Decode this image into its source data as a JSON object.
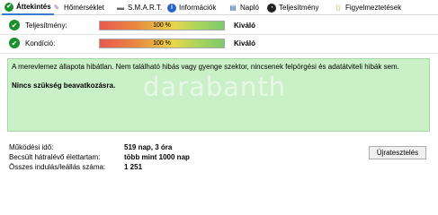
{
  "tabs": [
    {
      "label": "Áttekintés",
      "icon": "green-check-icon",
      "active": true
    },
    {
      "label": "Hőmérséklet",
      "icon": "thermometer-pencil-icon",
      "active": false
    },
    {
      "label": "S.M.A.R.T.",
      "icon": "disk-icon",
      "active": false
    },
    {
      "label": "Információk",
      "icon": "info-icon",
      "active": false
    },
    {
      "label": "Napló",
      "icon": "log-icon",
      "active": false
    },
    {
      "label": "Teljesítmény",
      "icon": "performance-gauge-icon",
      "active": false
    },
    {
      "label": "Figyelmeztetések",
      "icon": "warning-doc-icon",
      "active": false
    }
  ],
  "health": {
    "performance": {
      "label": "Teljesítmény:",
      "percent_text": "100 %",
      "value": 100,
      "status": "Kiváló"
    },
    "condition": {
      "label": "Kondíció:",
      "percent_text": "100 %",
      "value": 100,
      "status": "Kiváló"
    }
  },
  "panel": {
    "message": "A merevlemez állapota hibátlan. Nem található hibás vagy gyenge szektor, nincsenek felpörgési és adatátviteli hibák sem.",
    "bold_message": "Nincs szükség beavatkozásra.",
    "watermark": "darabanth",
    "background_color": "#c9f0c6"
  },
  "stats": [
    {
      "label": "Működési idő:",
      "value": "519 nap, 3 óra"
    },
    {
      "label": "Becsült hátralévő élettartam:",
      "value": "több mint 1000 nap"
    },
    {
      "label": "Összes indulás/leállás száma:",
      "value": "1 251"
    }
  ],
  "retest_button": "Újratesztelés"
}
